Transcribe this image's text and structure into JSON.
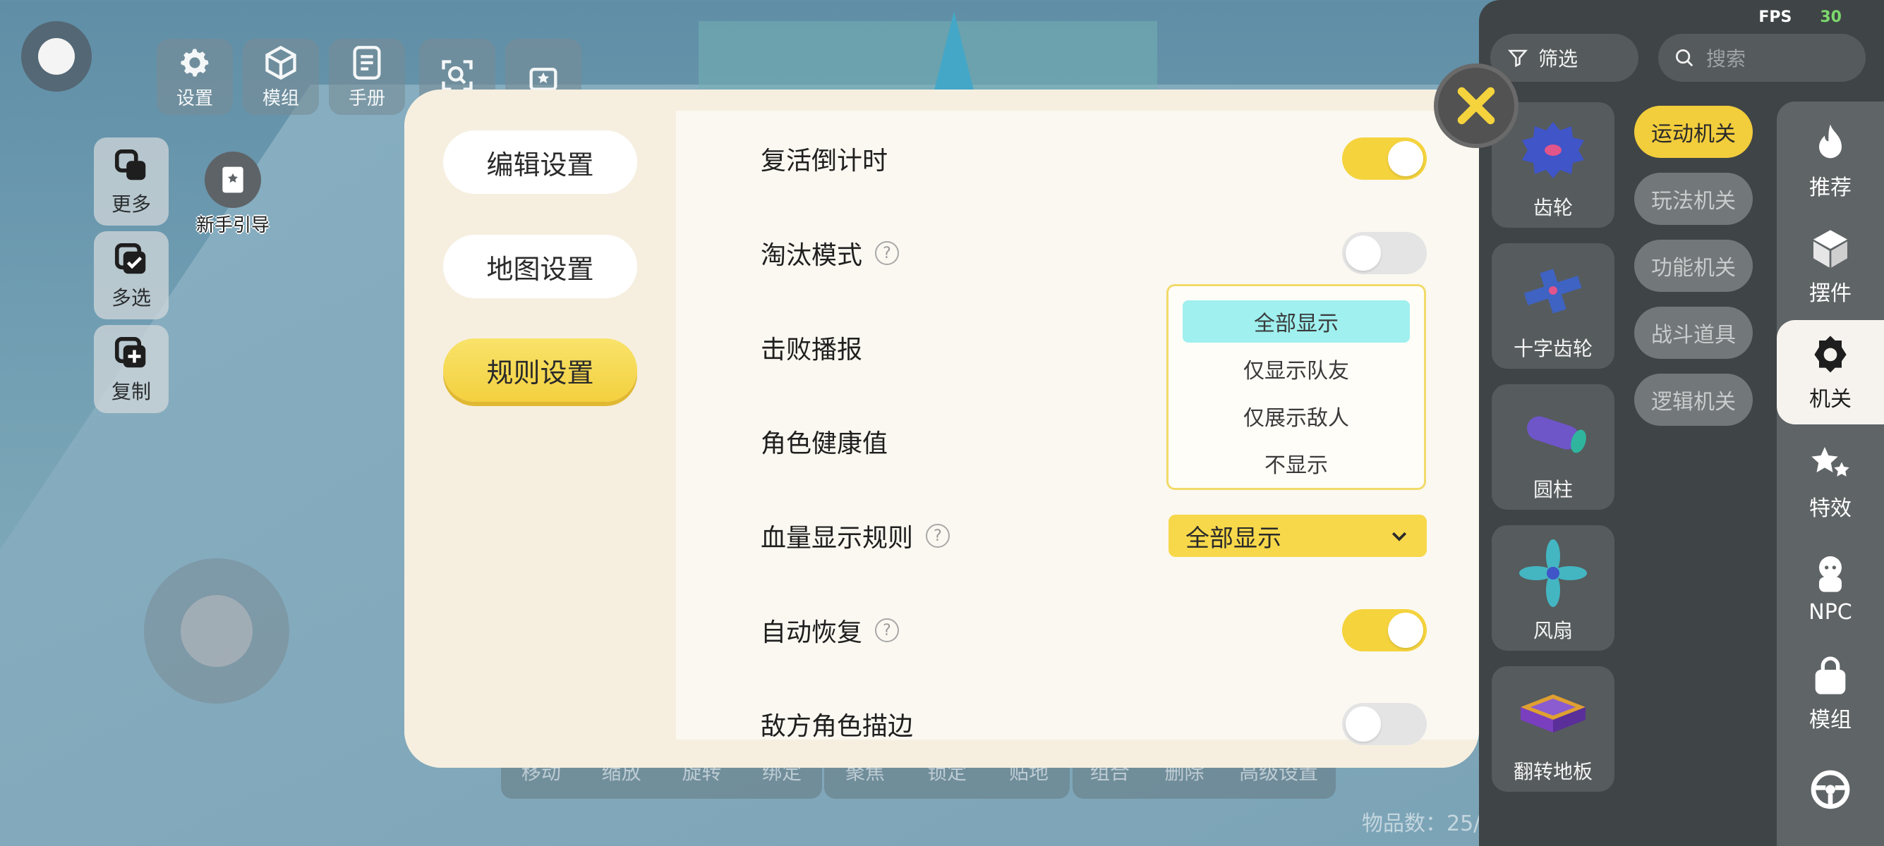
{
  "top_toolbar": {
    "items": [
      {
        "label": "设置",
        "icon": "gear-icon"
      },
      {
        "label": "模组",
        "icon": "cube-icon"
      },
      {
        "label": "手册",
        "icon": "book-icon"
      },
      {
        "label": "",
        "icon": "scan-icon"
      },
      {
        "label": "",
        "icon": "gift-icon"
      }
    ]
  },
  "side_tools": [
    {
      "label": "更多",
      "icon": "layers-icon"
    },
    {
      "label": "多选",
      "icon": "multi-select-icon"
    },
    {
      "label": "复制",
      "icon": "copy-icon"
    }
  ],
  "guide": {
    "label": "新手引导"
  },
  "bottom_bar": {
    "group1": [
      "移动",
      "缩放",
      "旋转",
      "绑定"
    ],
    "group2": [
      "聚焦",
      "锁定",
      "贴地"
    ],
    "group3": [
      "组合",
      "删除",
      "高级设置"
    ]
  },
  "item_count": "物品数：25/",
  "modal": {
    "nav": [
      {
        "label": "编辑设置",
        "active": false
      },
      {
        "label": "地图设置",
        "active": false
      },
      {
        "label": "规则设置",
        "active": true
      }
    ],
    "rows": [
      {
        "label": "复活倒计时",
        "help": false,
        "control": "toggle",
        "on": true
      },
      {
        "label": "淘汰模式",
        "help": true,
        "control": "toggle",
        "on": false
      },
      {
        "label": "击败播报",
        "help": false,
        "control": "none"
      },
      {
        "label": "角色健康值",
        "help": false,
        "control": "none"
      },
      {
        "label": "血量显示规则",
        "help": true,
        "control": "select",
        "value": "全部显示"
      },
      {
        "label": "自动恢复",
        "help": true,
        "control": "toggle",
        "on": true
      },
      {
        "label": "敌方角色描边",
        "help": false,
        "control": "toggle",
        "on": false
      }
    ],
    "dropdown": {
      "options": [
        "全部显示",
        "仅显示队友",
        "仅展示敌人",
        "不显示"
      ],
      "selected": "全部显示"
    },
    "help_glyph": "?"
  },
  "right_panel": {
    "fps_label": "FPS",
    "fps_value": "30",
    "filter_label": "筛选",
    "search_placeholder": "搜索",
    "categories": [
      {
        "label": "运动机关",
        "active": true
      },
      {
        "label": "玩法机关",
        "active": false
      },
      {
        "label": "功能机关",
        "active": false
      },
      {
        "label": "战斗道具",
        "active": false
      },
      {
        "label": "逻辑机关",
        "active": false
      }
    ],
    "items": [
      {
        "label": "齿轮",
        "icon": "gear-piece-icon"
      },
      {
        "label": "十字齿轮",
        "icon": "cross-gear-icon"
      },
      {
        "label": "圆柱",
        "icon": "cylinder-icon"
      },
      {
        "label": "风扇",
        "icon": "fan-icon"
      },
      {
        "label": "翻转地板",
        "icon": "flip-floor-icon"
      }
    ],
    "tabs": [
      {
        "label": "推荐",
        "icon": "flame-icon",
        "active": false
      },
      {
        "label": "摆件",
        "icon": "box-icon",
        "active": false
      },
      {
        "label": "机关",
        "icon": "mechanism-icon",
        "active": true
      },
      {
        "label": "特效",
        "icon": "stars-icon",
        "active": false
      },
      {
        "label": "NPC",
        "icon": "npc-icon",
        "active": false
      },
      {
        "label": "模组",
        "icon": "bag-icon",
        "active": false
      },
      {
        "label": "",
        "icon": "steering-wheel-icon",
        "active": false
      }
    ]
  },
  "colors": {
    "accent_yellow": "#f4d33d",
    "dropdown_highlight": "#9ff0ef",
    "panel_dark": "#3f4446",
    "fps_green": "#7dd86d"
  }
}
